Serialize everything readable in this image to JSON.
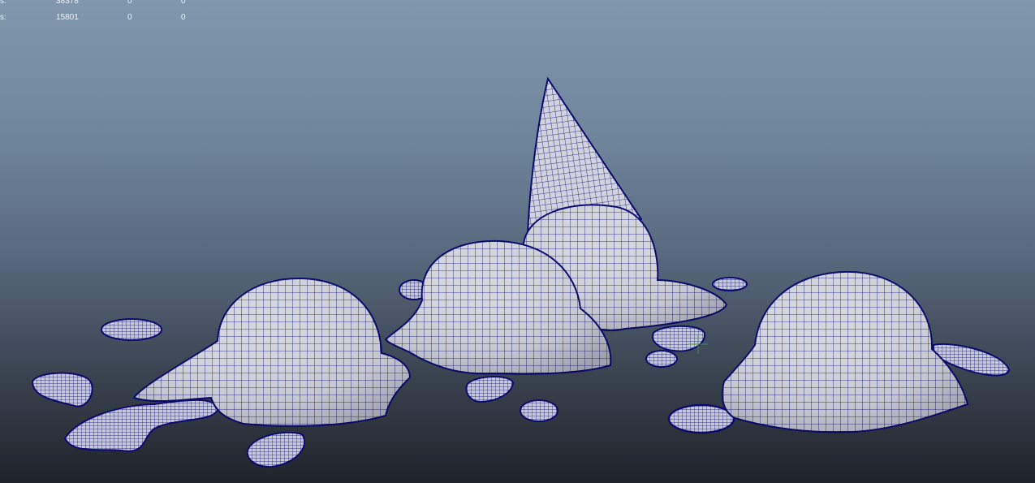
{
  "viewport": {
    "name": "Perspective viewport",
    "background_top": "#8197ae",
    "background_bottom": "#1f2329",
    "wire_color": "#0b0b6e",
    "mesh_color": "#d4d5dc"
  },
  "hud": {
    "rows": [
      {
        "label": "s:",
        "v1": "38378",
        "v2": "0",
        "v3": "0"
      },
      {
        "label": "s:",
        "v1": "15801",
        "v2": "0",
        "v3": "0"
      }
    ]
  },
  "scene": {
    "objects": [
      {
        "name": "melted-scoop-left",
        "type": "scoop"
      },
      {
        "name": "melted-scoop-center",
        "type": "scoop"
      },
      {
        "name": "ice-cream-cone",
        "type": "cone"
      },
      {
        "name": "melted-scoop-right",
        "type": "scoop"
      },
      {
        "name": "melt-puddle",
        "type": "puddle",
        "count": 12
      }
    ]
  }
}
